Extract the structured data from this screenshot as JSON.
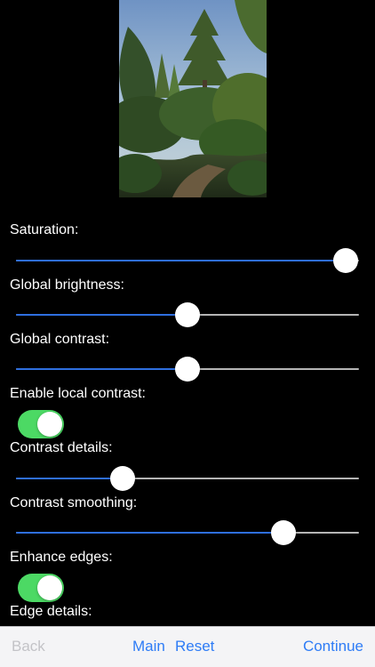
{
  "settings": {
    "saturation_label": "Saturation:",
    "saturation_value": 0.96,
    "global_brightness_label": "Global brightness:",
    "global_brightness_value": 0.5,
    "global_contrast_label": "Global contrast:",
    "global_contrast_value": 0.5,
    "enable_local_contrast_label": "Enable local contrast:",
    "enable_local_contrast_on": true,
    "contrast_details_label": "Contrast details:",
    "contrast_details_value": 0.31,
    "contrast_smoothing_label": "Contrast smoothing:",
    "contrast_smoothing_value": 0.78,
    "enhance_edges_label": "Enhance edges:",
    "enhance_edges_on": true,
    "edge_details_label": "Edge details:"
  },
  "toolbar": {
    "back_label": "Back",
    "main_label": "Main",
    "reset_label": "Reset",
    "continue_label": "Continue"
  },
  "colors": {
    "accent": "#2e7cf6",
    "slider_fill": "#2f6fe0",
    "toggle_on": "#4cd964",
    "disabled": "#c3c3c7"
  }
}
